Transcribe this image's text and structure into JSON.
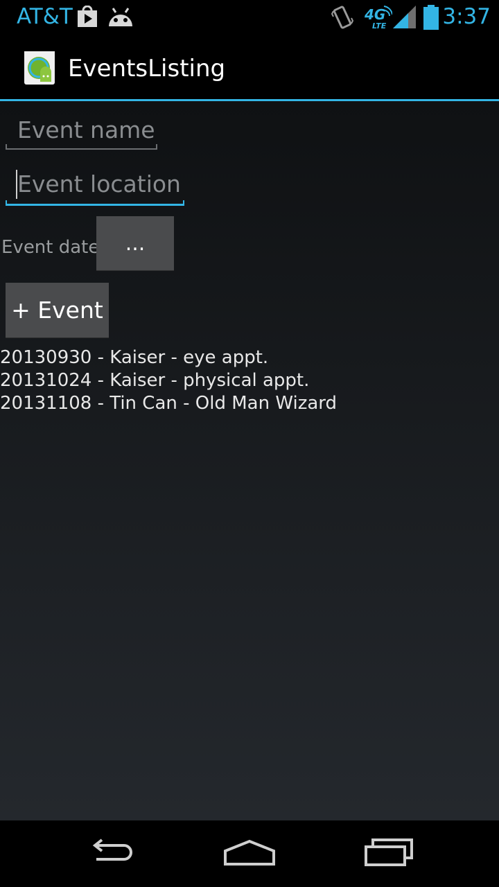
{
  "status_bar": {
    "carrier": "AT&T",
    "time": "3:37",
    "network_badge_top": "4G",
    "network_badge_bottom": "LTE",
    "icons": [
      "play-store-notification-icon",
      "android-debug-icon",
      "vibrate-icon",
      "4g-lte-icon",
      "signal-icon",
      "battery-icon"
    ],
    "accent_color": "#33b5e5"
  },
  "action_bar": {
    "title": "EventsListing",
    "icon": "app-icon"
  },
  "form": {
    "name_placeholder": "Event name",
    "location_placeholder": "Event location",
    "date_label": "Event date",
    "date_button_label": "...",
    "add_button_label": "+ Event"
  },
  "events": [
    "20130930 - Kaiser - eye appt.",
    "20131024 - Kaiser - physical appt.",
    "20131108 - Tin Can - Old Man Wizard"
  ],
  "nav_bar": {
    "buttons": [
      "back-icon",
      "home-icon",
      "recent-apps-icon"
    ]
  }
}
